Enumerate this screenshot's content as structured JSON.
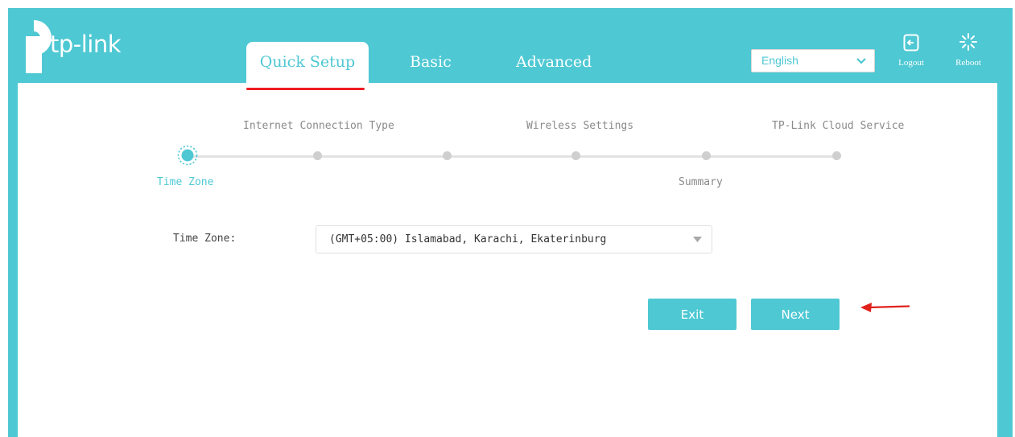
{
  "brand": {
    "logo_text": "tp-link"
  },
  "nav": {
    "tabs": [
      {
        "label": "Quick Setup",
        "active": true
      },
      {
        "label": "Basic",
        "active": false
      },
      {
        "label": "Advanced",
        "active": false
      }
    ]
  },
  "header": {
    "language": {
      "selected": "English"
    },
    "logout_label": "Logout",
    "reboot_label": "Reboot"
  },
  "wizard": {
    "steps_top": [
      "Internet Connection Type",
      "Wireless Settings",
      "TP-Link Cloud Service"
    ],
    "steps_bottom": [
      "Time Zone",
      "Summary"
    ],
    "current_step": "Time Zone"
  },
  "form": {
    "time_zone_label": "Time Zone:",
    "time_zone_value": "(GMT+05:00) Islamabad, Karachi, Ekaterinburg"
  },
  "actions": {
    "exit_label": "Exit",
    "next_label": "Next"
  },
  "colors": {
    "accent": "#4ec8d3",
    "underline": "#ee1c24",
    "arrow": "#e0211c"
  },
  "icons": {
    "logo": "tp-link-logo-icon",
    "language": "chevron-down-icon",
    "logout": "logout-icon",
    "reboot": "reboot-icon",
    "select": "caret-down-icon",
    "annotation": "red-arrow-icon"
  }
}
